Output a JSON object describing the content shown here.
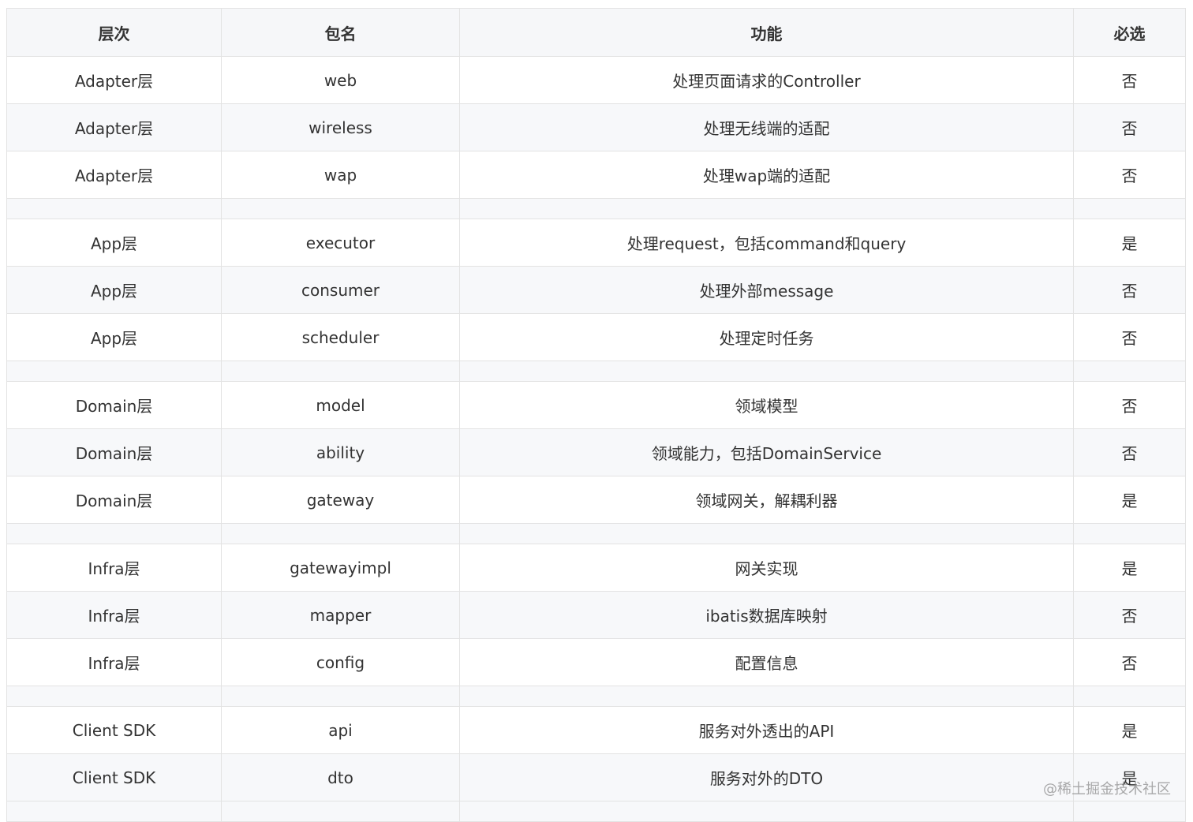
{
  "table": {
    "headers": [
      "层次",
      "包名",
      "功能",
      "必选"
    ],
    "groups": [
      {
        "rows": [
          [
            "Adapter层",
            "web",
            "处理页面请求的Controller",
            "否"
          ],
          [
            "Adapter层",
            "wireless",
            "处理无线端的适配",
            "否"
          ],
          [
            "Adapter层",
            "wap",
            "处理wap端的适配",
            "否"
          ]
        ]
      },
      {
        "rows": [
          [
            "App层",
            "executor",
            "处理request，包括command和query",
            "是"
          ],
          [
            "App层",
            "consumer",
            "处理外部message",
            "否"
          ],
          [
            "App层",
            "scheduler",
            "处理定时任务",
            "否"
          ]
        ]
      },
      {
        "rows": [
          [
            "Domain层",
            "model",
            "领域模型",
            "否"
          ],
          [
            "Domain层",
            "ability",
            "领域能力，包括DomainService",
            "否"
          ],
          [
            "Domain层",
            "gateway",
            "领域网关，解耦利器",
            "是"
          ]
        ]
      },
      {
        "rows": [
          [
            "Infra层",
            "gatewayimpl",
            "网关实现",
            "是"
          ],
          [
            "Infra层",
            "mapper",
            "ibatis数据库映射",
            "否"
          ],
          [
            "Infra层",
            "config",
            "配置信息",
            "否"
          ]
        ]
      },
      {
        "rows": [
          [
            "Client SDK",
            "api",
            "服务对外透出的API",
            "是"
          ],
          [
            "Client SDK",
            "dto",
            "服务对外的DTO",
            "是"
          ]
        ]
      }
    ]
  },
  "watermark": "@稀土掘金技术社区"
}
